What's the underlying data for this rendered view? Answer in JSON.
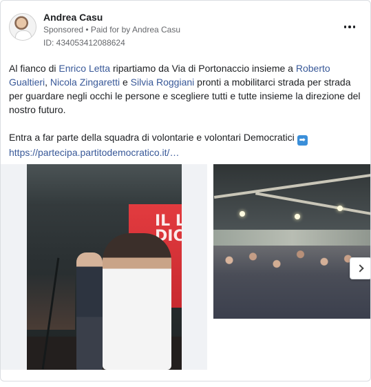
{
  "post": {
    "page_name": "Andrea Casu",
    "sponsored_label": "Sponsored",
    "separator": " • ",
    "paid_for_prefix": "Paid for by ",
    "paid_for_name": "Andrea Casu",
    "ad_id": "ID: 434053412088624",
    "more_icon": "more-horizontal-icon"
  },
  "body": {
    "p1_t1": "Al fianco di ",
    "mention1": "Enrico Letta",
    "p1_t2": " ripartiamo da Via di Portonaccio insieme a ",
    "mention2": "Roberto Gualtieri",
    "p1_t3": ", ",
    "mention3": "Nicola Zingaretti",
    "p1_t4": " e ",
    "mention4": "Silvia Roggiani",
    "p1_t5": " pronti a mobilitarci strada per strada per guardare negli occhi le persone e scegliere tutti e tutte insieme la direzione del nostro futuro.",
    "p2_t1": "Entra a far parte della squadra di volontarie e volontari Democratici ",
    "emoji_arrow": "➡",
    "link": "https://partecipa.partitodemocratico.it/…"
  },
  "carousel": {
    "slide1_screen_text": "IL LA\nDIC",
    "next_icon": "chevron-right-icon"
  },
  "colors": {
    "link": "#385898",
    "muted": "#65676b",
    "stage_red": "#e23b3f"
  }
}
